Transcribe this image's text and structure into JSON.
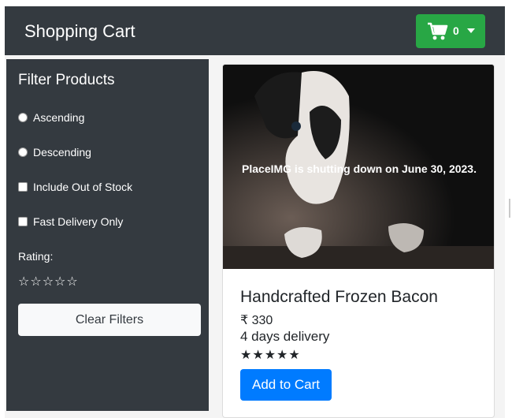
{
  "navbar": {
    "brand": "Shopping Cart",
    "cart_count": "0",
    "cart_icon": "shopping-cart-icon",
    "dropdown_icon": "caret-down-icon",
    "cart_button_color": "#28a745"
  },
  "sidebar": {
    "title": "Filter Products",
    "options": [
      {
        "label": "Ascending",
        "type": "radio"
      },
      {
        "label": "Descending",
        "type": "radio"
      },
      {
        "label": "Include Out of Stock",
        "type": "checkbox"
      },
      {
        "label": "Fast Delivery Only",
        "type": "checkbox"
      }
    ],
    "rating_label": "Rating:",
    "rating_value": 0,
    "rating_max": 5,
    "clear_label": "Clear Filters"
  },
  "product": {
    "image_text": "PlaceIMG is shutting down on June 30, 2023.",
    "name": "Handcrafted Frozen Bacon",
    "price": "₹ 330",
    "delivery": "4 days delivery",
    "rating": 5,
    "add_label": "Add to Cart",
    "add_button_color": "#007bff"
  }
}
